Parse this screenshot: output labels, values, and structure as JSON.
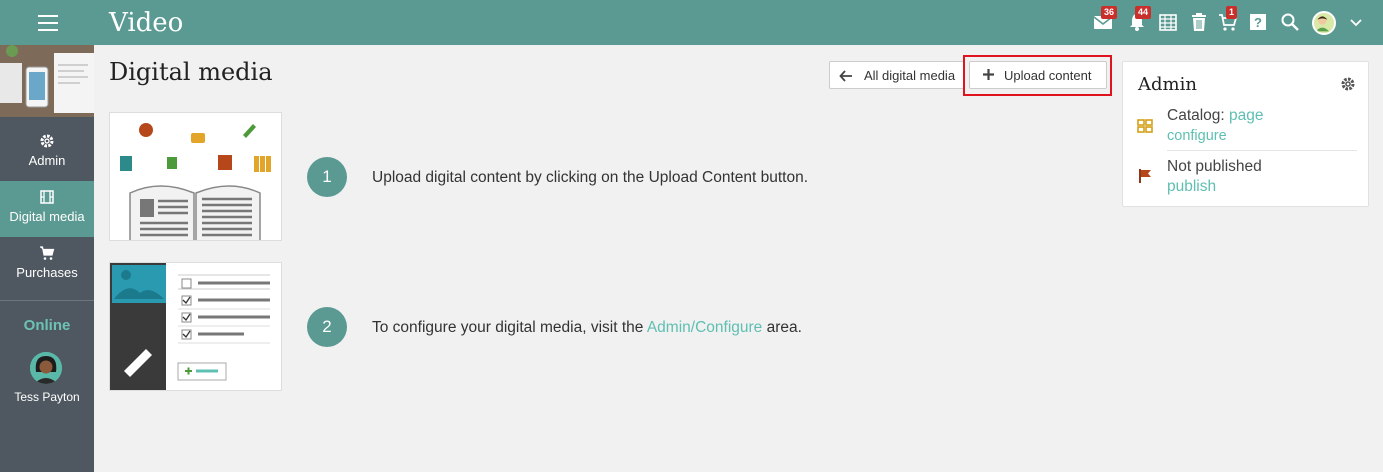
{
  "app": {
    "title": "Video"
  },
  "topbar": {
    "badges": {
      "messages": "36",
      "notifications": "44",
      "cart": "1"
    },
    "icons": [
      "menu-icon",
      "envelope-icon",
      "bell-icon",
      "calendar-icon",
      "trash-icon",
      "cart-icon",
      "help-icon",
      "search-icon",
      "avatar",
      "chevron-down-icon"
    ]
  },
  "sidebar": {
    "items": [
      {
        "label": "Admin",
        "icon": "gear-icon"
      },
      {
        "label": "Digital media",
        "icon": "film-icon"
      },
      {
        "label": "Purchases",
        "icon": "cart-icon"
      }
    ],
    "online_label": "Online",
    "user_name": "Tess Payton"
  },
  "main": {
    "title": "Digital media",
    "buttons": {
      "all": "All digital media",
      "upload": "Upload content"
    },
    "steps": [
      {
        "number": "1",
        "text": "Upload digital content by clicking on the Upload Content button."
      },
      {
        "number": "2",
        "text_before": "To configure your digital media, visit the ",
        "link": "Admin/Configure",
        "text_after": " area."
      }
    ]
  },
  "admin_panel": {
    "title": "Admin",
    "catalog_label": "Catalog: ",
    "catalog_link": "page",
    "configure_link": "configure",
    "status_text": "Not published",
    "publish_link": "publish"
  },
  "colors": {
    "accent": "#5a9a92",
    "link": "#5ebfb2",
    "sidebar": "#4f5860",
    "highlight": "#e0141e"
  }
}
